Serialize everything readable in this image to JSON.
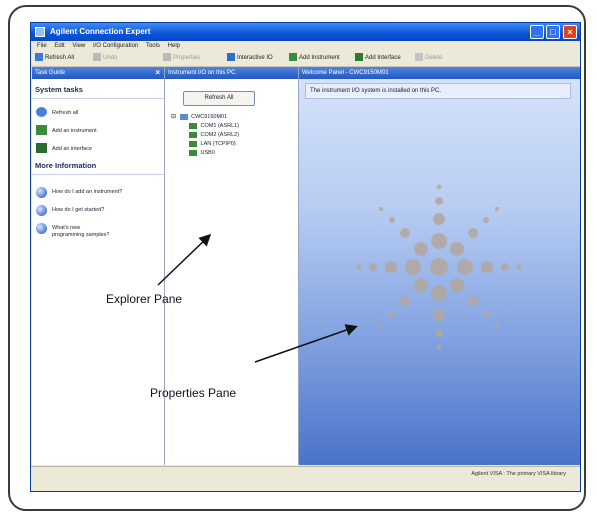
{
  "window": {
    "title": "Agilent Connection Expert"
  },
  "menu": [
    "File",
    "Edit",
    "View",
    "I/O Configuration",
    "Tools",
    "Help"
  ],
  "toolbar": {
    "items": [
      {
        "label": "Refresh All",
        "icon": "refresh-icon",
        "enabled": true
      },
      {
        "label": "Undo",
        "icon": "undo-icon",
        "enabled": false
      },
      {
        "label": "Properties",
        "icon": "properties-icon",
        "enabled": false
      },
      {
        "label": "Interactive IO",
        "icon": "interactive-io-icon",
        "enabled": true
      },
      {
        "label": "Add Instrument",
        "icon": "add-instrument-icon",
        "enabled": true
      },
      {
        "label": "Add Interface",
        "icon": "add-interface-icon",
        "enabled": true
      },
      {
        "label": "Delete",
        "icon": "delete-icon",
        "enabled": false
      }
    ]
  },
  "task_pane": {
    "header": "Task Guide",
    "system_tasks_title": "System tasks",
    "tasks": [
      {
        "label": "Refresh all",
        "icon": "refresh-icon"
      },
      {
        "label": "Add an instrument",
        "icon": "add-instrument-icon"
      },
      {
        "label": "Add an interface",
        "icon": "add-interface-icon"
      }
    ],
    "more_info_title": "More Information",
    "info_links": [
      {
        "label": "How do I add an instrument?",
        "icon": "info-icon"
      },
      {
        "label": "How do I get started?",
        "icon": "info-icon"
      },
      {
        "label": "What's new",
        "label2": "programming samples?",
        "icon": "info-icon"
      }
    ]
  },
  "explorer": {
    "header": "Instrument I/O on this PC",
    "refresh_label": "Refresh All",
    "tree": [
      {
        "label": "CWC9150M01",
        "level": 0
      },
      {
        "label": "COM1 (ASRL1)",
        "level": 1
      },
      {
        "label": "COM2 (ASRL2)",
        "level": 1
      },
      {
        "label": "LAN (TCPIP0)",
        "level": 1
      },
      {
        "label": "USB0",
        "level": 1
      }
    ]
  },
  "properties": {
    "header": "Welcome Panel - CWC9150M01",
    "message": "The instrument I/O system is installed on this PC."
  },
  "statusbar": {
    "text": "Agilent VISA : The primary VISA library"
  },
  "callouts": {
    "explorer": "Explorer Pane",
    "properties": "Properties Pane"
  },
  "colors": {
    "titlebar": "#0a53d9",
    "pane_header": "#2457c2",
    "properties_bg": "#7ea0e0"
  }
}
